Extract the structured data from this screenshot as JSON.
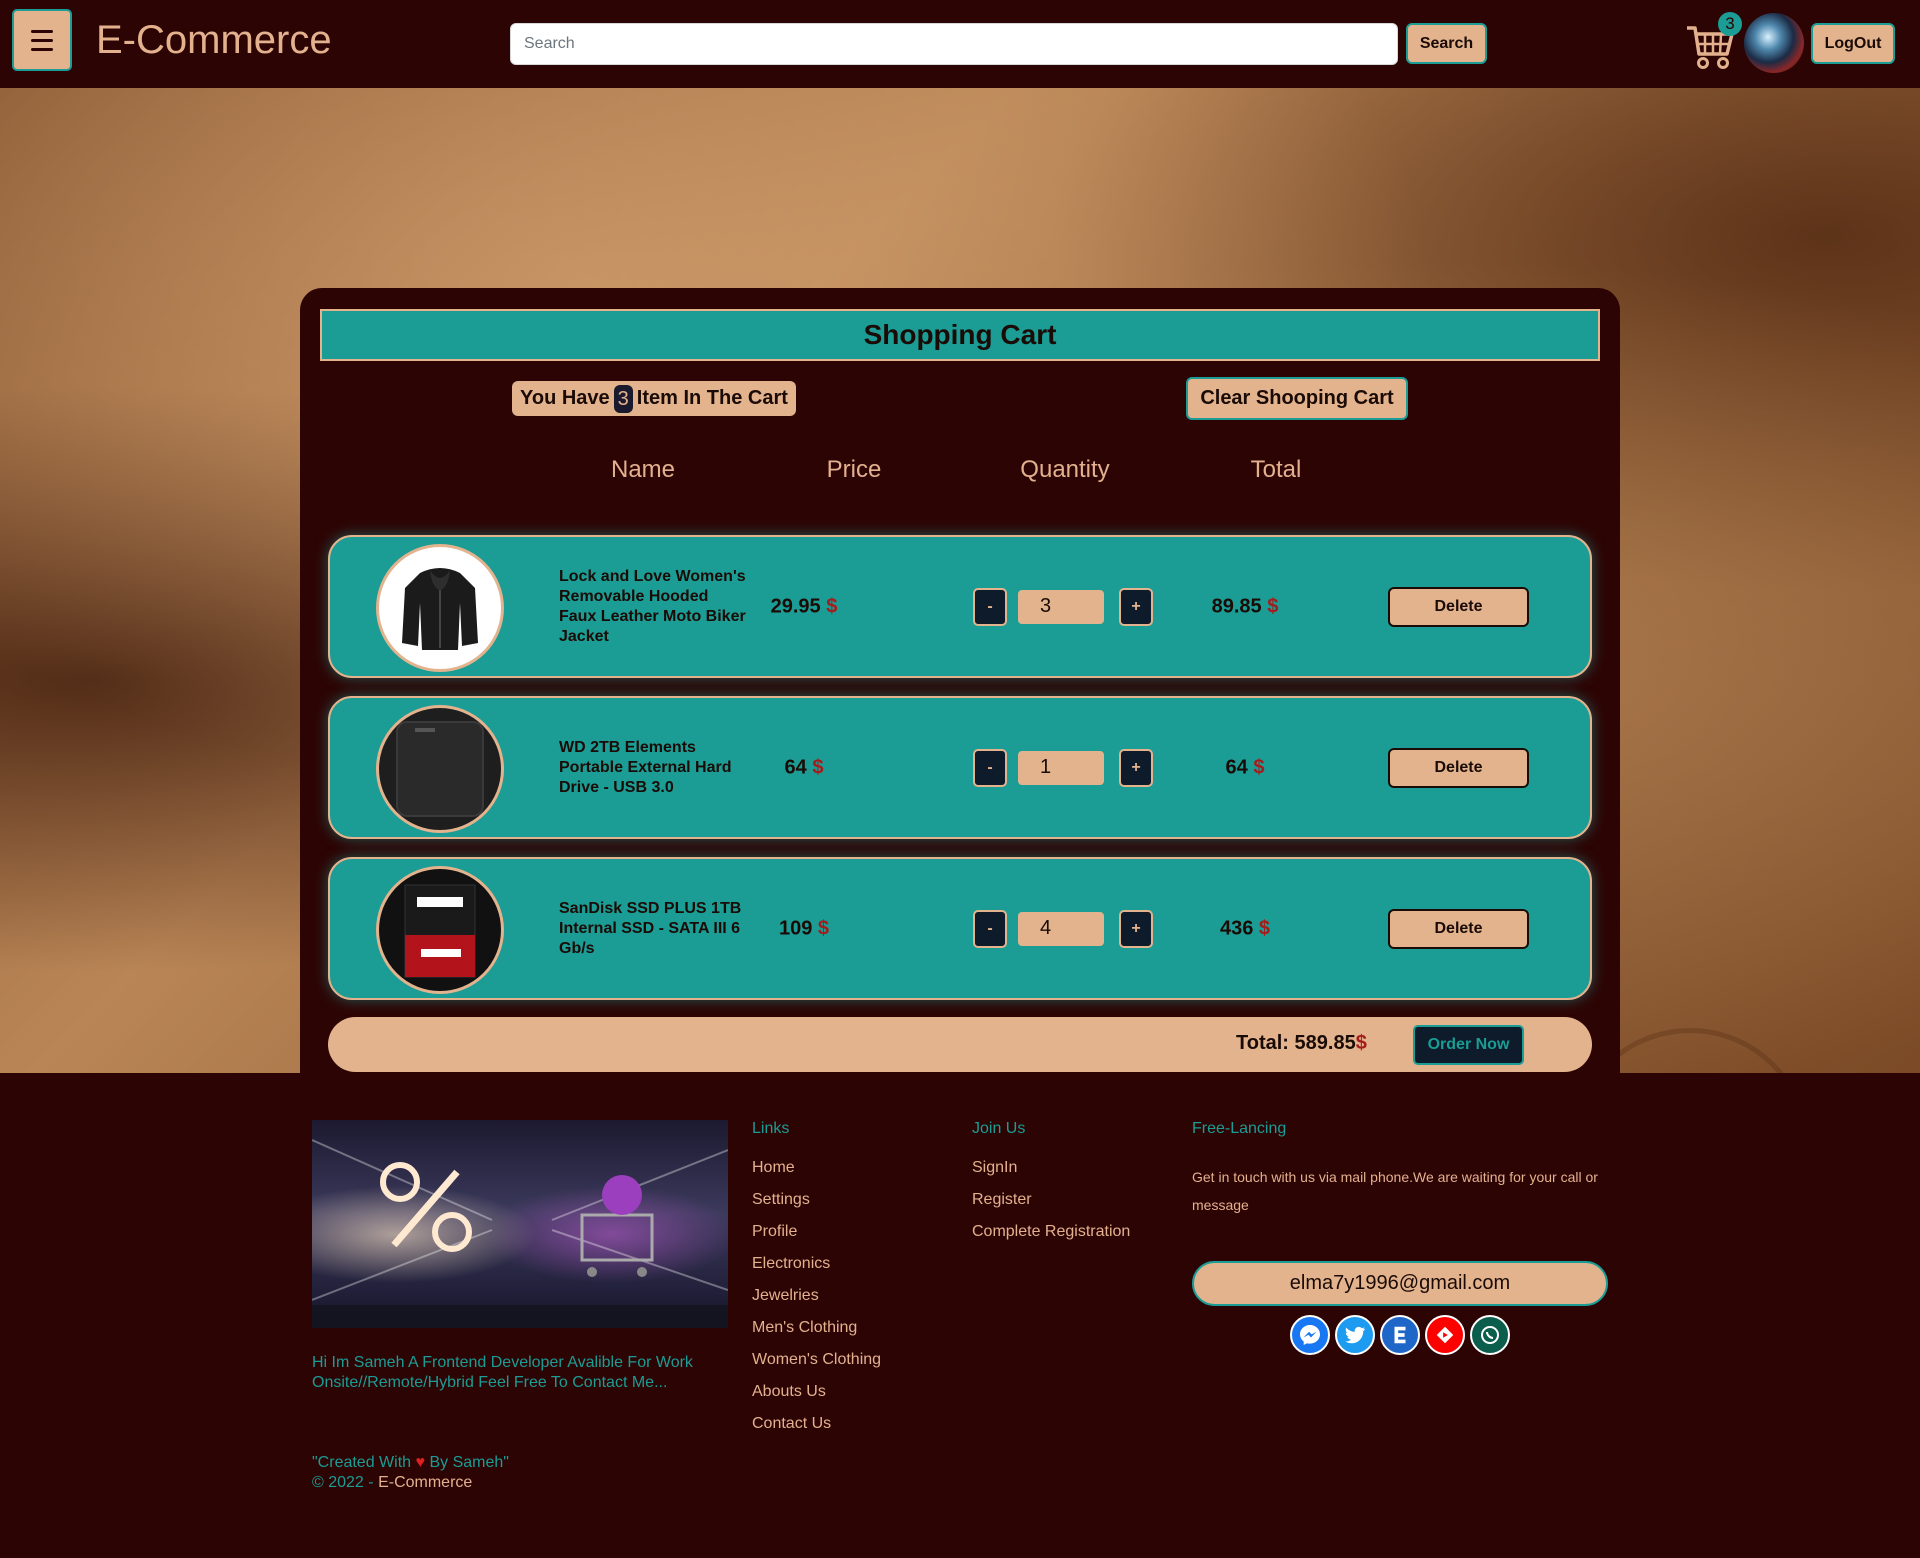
{
  "navbar": {
    "brand": "E-Commerce",
    "search_placeholder": "Search",
    "search_label": "Search",
    "cart_count": "3",
    "logout_label": "LogOut"
  },
  "cart": {
    "title": "Shopping Cart",
    "count_prefix": "You Have",
    "count": "3",
    "count_suffix": "Item In The Cart",
    "clear_label": "Clear Shooping Cart",
    "columns": [
      "Name",
      "Price",
      "Quantity",
      "Total"
    ],
    "items": [
      {
        "name": "Lock and Love Women's Removable Hooded Faux Leather Moto Biker Jacket",
        "price": "29.95",
        "quantity": "3",
        "total": "89.85",
        "image": "jacket-image"
      },
      {
        "name": "WD 2TB Elements Portable External Hard Drive - USB 3.0",
        "price": "64",
        "quantity": "1",
        "total": "64",
        "image": "hard-drive-image"
      },
      {
        "name": "SanDisk SSD PLUS 1TB Internal SSD - SATA III 6 Gb/s",
        "price": "109",
        "quantity": "4",
        "total": "436",
        "image": "ssd-image"
      }
    ],
    "currency": "$",
    "minus_label": "-",
    "plus_label": "+",
    "delete_label": "Delete",
    "total_label": "Total:",
    "total_value": "589.85",
    "order_label": "Order Now"
  },
  "footer": {
    "about": "Hi Im Sameh A Frontend Developer Avalible For Work Onsite//Remote/Hybrid Feel Free To Contact Me...",
    "credit_prefix": "\"Created With",
    "credit_suffix": "By Sameh\"",
    "copyright": "© 2022 -",
    "copyright_brand": "E-Commerce",
    "links_head": "Links",
    "links": [
      "Home",
      "Settings",
      "Profile",
      "Electronics",
      "Jewelries",
      "Men's Clothing",
      "Women's Clothing",
      "Abouts Us",
      "Contact Us"
    ],
    "join_head": "Join Us",
    "join": [
      "SignIn",
      "Register",
      "Complete Registration"
    ],
    "free_head": "Free-Lancing",
    "free_text": "Get in touch with us via mail phone.We are waiting for your call or message",
    "email": "elma7y1996@gmail.com",
    "socials": [
      {
        "name": "social-icon-1",
        "color": "#1877f2"
      },
      {
        "name": "social-icon-2",
        "color": "#1d9bf0"
      },
      {
        "name": "social-icon-3",
        "color": "#1e66c8"
      },
      {
        "name": "social-icon-4",
        "color": "#ff0000"
      },
      {
        "name": "social-icon-5",
        "color": "#0b5e4b"
      }
    ]
  },
  "colors": {
    "background": "#2d0404",
    "teal": "#1b9c94",
    "tan": "#e3b38e",
    "currency_red": "#a51c1c"
  }
}
